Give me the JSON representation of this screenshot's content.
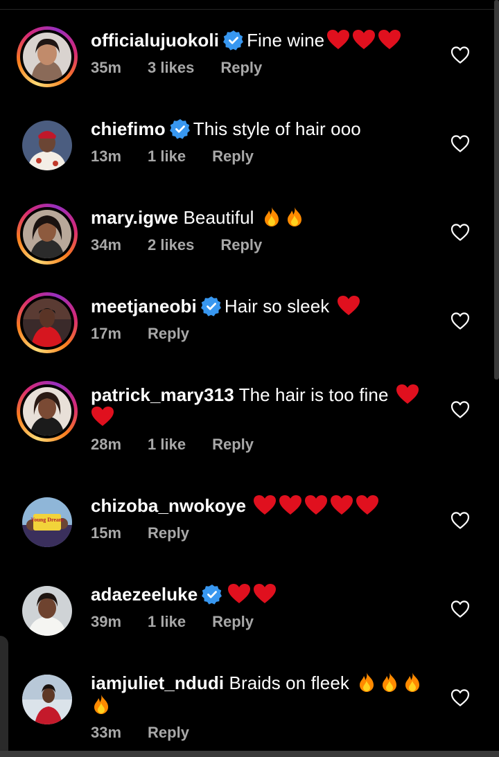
{
  "colors": {
    "background": "#000000",
    "text": "#ffffff",
    "meta": "#a8a8a8",
    "verified": "#3897f0",
    "heart_red": "#e0101e",
    "fire": "#ff8a00"
  },
  "comments": [
    {
      "username": "officialujuokoli",
      "verified": true,
      "text": "Fine wine",
      "emoji": [
        "heart",
        "heart",
        "heart"
      ],
      "time": "35m",
      "likes": "3 likes",
      "reply": "Reply",
      "story_ring": true,
      "avatar": "woman-portrait-avatar"
    },
    {
      "username": "chiefimo",
      "verified": true,
      "text": "This style of hair ooo",
      "emoji": [],
      "time": "13m",
      "likes": "1 like",
      "reply": "Reply",
      "story_ring": false,
      "avatar": "man-red-cap-avatar"
    },
    {
      "username": "mary.igwe",
      "verified": false,
      "text": "Beautiful ",
      "emoji": [
        "fire",
        "fire"
      ],
      "time": "34m",
      "likes": "2 likes",
      "reply": "Reply",
      "story_ring": true,
      "avatar": "woman-portrait-avatar"
    },
    {
      "username": "meetjaneobi",
      "verified": true,
      "text": "Hair so sleek ",
      "emoji": [
        "heart"
      ],
      "time": "17m",
      "likes": "",
      "reply": "Reply",
      "story_ring": true,
      "avatar": "woman-red-dress-avatar"
    },
    {
      "username": "patrick_mary313",
      "verified": false,
      "text": "The hair is too fine ",
      "emoji": [
        "heart",
        "heart"
      ],
      "time": "28m",
      "likes": "1 like",
      "reply": "Reply",
      "story_ring": true,
      "avatar": "woman-portrait-avatar"
    },
    {
      "username": "chizoba_nwokoye",
      "verified": false,
      "text": "",
      "emoji": [
        "heart",
        "heart",
        "heart",
        "heart",
        "heart"
      ],
      "time": "15m",
      "likes": "",
      "reply": "Reply",
      "story_ring": false,
      "avatar": "movie-poster-avatar",
      "avatar_text": "Young Dream"
    },
    {
      "username": "adaezeeluke",
      "verified": true,
      "text": "",
      "emoji": [
        "heart",
        "heart"
      ],
      "time": "39m",
      "likes": "1 like",
      "reply": "Reply",
      "story_ring": false,
      "avatar": "woman-portrait-avatar"
    },
    {
      "username": "iamjuliet_ndudi",
      "verified": false,
      "text": "Braids on fleek ",
      "emoji": [
        "fire",
        "fire",
        "fire",
        "fire"
      ],
      "time": "33m",
      "likes": "",
      "reply": "Reply",
      "story_ring": false,
      "avatar": "woman-outdoor-avatar"
    }
  ]
}
